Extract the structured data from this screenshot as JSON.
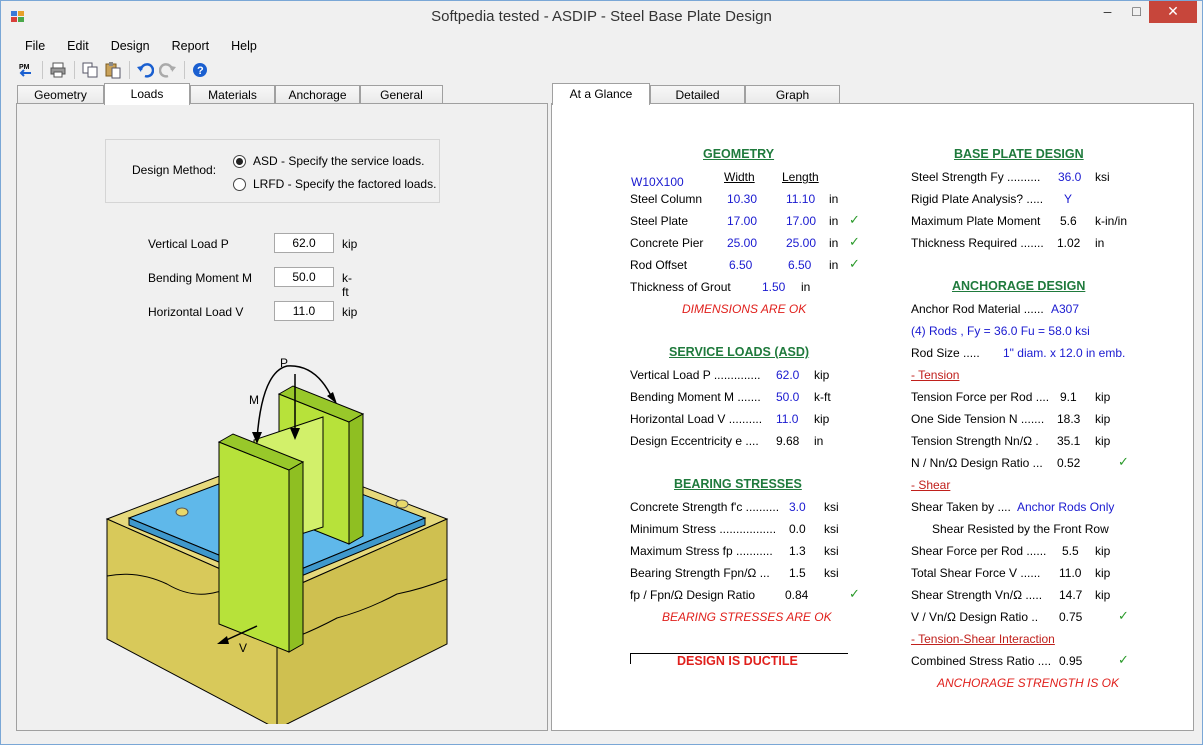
{
  "window": {
    "title": "Softpedia tested - ASDIP - Steel Base Plate Design"
  },
  "menu": [
    "File",
    "Edit",
    "Design",
    "Report",
    "Help"
  ],
  "toolbar": {
    "pm_label": "PM"
  },
  "left_tabs": [
    "Geometry",
    "Loads",
    "Materials",
    "Anchorage",
    "General"
  ],
  "right_tabs": [
    "At a Glance",
    "Detailed",
    "Graph"
  ],
  "loads": {
    "design_method_label": "Design Method:",
    "asd_label": "ASD - Specify the service loads.",
    "lrfd_label": "LRFD - Specify the factored loads.",
    "vertical": {
      "label": "Vertical Load  P",
      "value": "62.0",
      "unit": "kip"
    },
    "moment": {
      "label": "Bending Moment  M",
      "value": "50.0",
      "unit": "k-ft"
    },
    "horizontal": {
      "label": "Horizontal Load  V",
      "value": "11.0",
      "unit": "kip"
    },
    "diagram": {
      "p": "P",
      "m": "M",
      "v": "V"
    }
  },
  "glance": {
    "geometry": {
      "heading": "GEOMETRY",
      "section": "W10X100",
      "width_header": "Width",
      "length_header": "Length",
      "rows": [
        {
          "label": "Steel Column",
          "w": "10.30",
          "l": "11.10",
          "unit": "in",
          "check": ""
        },
        {
          "label": "Steel Plate",
          "w": "17.00",
          "l": "17.00",
          "unit": "in",
          "check": "✓"
        },
        {
          "label": "Concrete Pier",
          "w": "25.00",
          "l": "25.00",
          "unit": "in",
          "check": "✓"
        },
        {
          "label": "Rod Offset",
          "w": "6.50",
          "l": "6.50",
          "unit": "in",
          "check": "✓"
        }
      ],
      "grout_label": "Thickness of Grout",
      "grout_value": "1.50",
      "grout_unit": "in",
      "status": "DIMENSIONS ARE OK"
    },
    "service": {
      "heading": "SERVICE LOADS (ASD)",
      "rows": [
        {
          "label": "Vertical Load  P  ..............",
          "value": "62.0",
          "unit": "kip"
        },
        {
          "label": "Bending Moment  M  .......",
          "value": "50.0",
          "unit": "k-ft"
        },
        {
          "label": "Horizontal Load  V  ..........",
          "value": "11.0",
          "unit": "kip"
        },
        {
          "label": "Design Eccentricity  e  ....",
          "value": "9.68",
          "unit": "in"
        }
      ]
    },
    "bearing": {
      "heading": "BEARING STRESSES",
      "rows": [
        {
          "label": "Concrete Strength  f'c  ..........",
          "value": "3.0",
          "unit": "ksi",
          "check": "",
          "blue": true
        },
        {
          "label": "Minimum Stress  .................",
          "value": "0.0",
          "unit": "ksi",
          "check": "",
          "blue": false
        },
        {
          "label": "Maximum Stress  fp  ...........",
          "value": "1.3",
          "unit": "ksi",
          "check": "",
          "blue": false
        },
        {
          "label": "Bearing Strength  Fpn/Ω  ...",
          "value": "1.5",
          "unit": "ksi",
          "check": "",
          "blue": false
        },
        {
          "label": "fp / Fpn/Ω Design Ratio",
          "value": "0.84",
          "unit": "",
          "check": "✓",
          "blue": false
        }
      ],
      "status": "BEARING STRESSES ARE OK"
    },
    "ductile": "DESIGN IS DUCTILE",
    "plate": {
      "heading": "BASE PLATE DESIGN",
      "rows": [
        {
          "label": "Steel Strength  Fy  ..........",
          "value": "36.0",
          "unit": "ksi",
          "blue": true
        },
        {
          "label": "Rigid Plate Analysis?  .....",
          "value": "Y",
          "unit": "",
          "blue": true
        },
        {
          "label": "Maximum Plate Moment",
          "value": "5.6",
          "unit": "k-in/in",
          "blue": false
        },
        {
          "label": "Thickness Required  .......",
          "value": "1.02",
          "unit": "in",
          "blue": false
        }
      ]
    },
    "anchorage": {
      "heading": "ANCHORAGE DESIGN",
      "material_label": "Anchor Rod Material  ......",
      "material_value": "A307",
      "rods_line": "(4)  Rods ,  Fy = 36.0   Fu = 58.0 ksi",
      "size_label": "Rod Size  .....",
      "size_value": "1\" diam. x 12.0 in emb.",
      "tension_label": "- Tension",
      "tension_rows": [
        {
          "label": "Tension Force per Rod  ....",
          "value": "9.1",
          "unit": "kip",
          "check": ""
        },
        {
          "label": "One Side Tension  N  .......",
          "value": "18.3",
          "unit": "kip",
          "check": ""
        },
        {
          "label": "Tension Strength  Nn/Ω  .",
          "value": "35.1",
          "unit": "kip",
          "check": ""
        },
        {
          "label": "N / Nn/Ω Design Ratio  ...",
          "value": "0.52",
          "unit": "",
          "check": "✓"
        }
      ],
      "shear_label": "- Shear",
      "shear_taken_label": "Shear Taken by  ....",
      "shear_taken_value": "Anchor Rods Only",
      "front_row": "Shear Resisted by the Front Row",
      "shear_rows": [
        {
          "label": "Shear Force per Rod  ......",
          "value": "5.5",
          "unit": "kip",
          "check": ""
        },
        {
          "label": "Total Shear Force  V  ......",
          "value": "11.0",
          "unit": "kip",
          "check": ""
        },
        {
          "label": "Shear Strength  Vn/Ω  .....",
          "value": "14.7",
          "unit": "kip",
          "check": ""
        },
        {
          "label": "V / Vn/Ω Design Ratio  ..",
          "value": "0.75",
          "unit": "",
          "check": "✓"
        }
      ],
      "interaction_label": "- Tension-Shear Interaction",
      "combined_label": "Combined Stress Ratio  ....",
      "combined_value": "0.95",
      "combined_check": "✓",
      "status": "ANCHORAGE STRENGTH IS OK"
    }
  },
  "colors": {
    "heading_green": "#1f7a3c",
    "value_blue": "#1a1ad0",
    "status_red": "#e0201c",
    "plate_blue": "#5fb8ea",
    "column_green": "#b7e23a",
    "pier_tan": "#e0d57a"
  }
}
